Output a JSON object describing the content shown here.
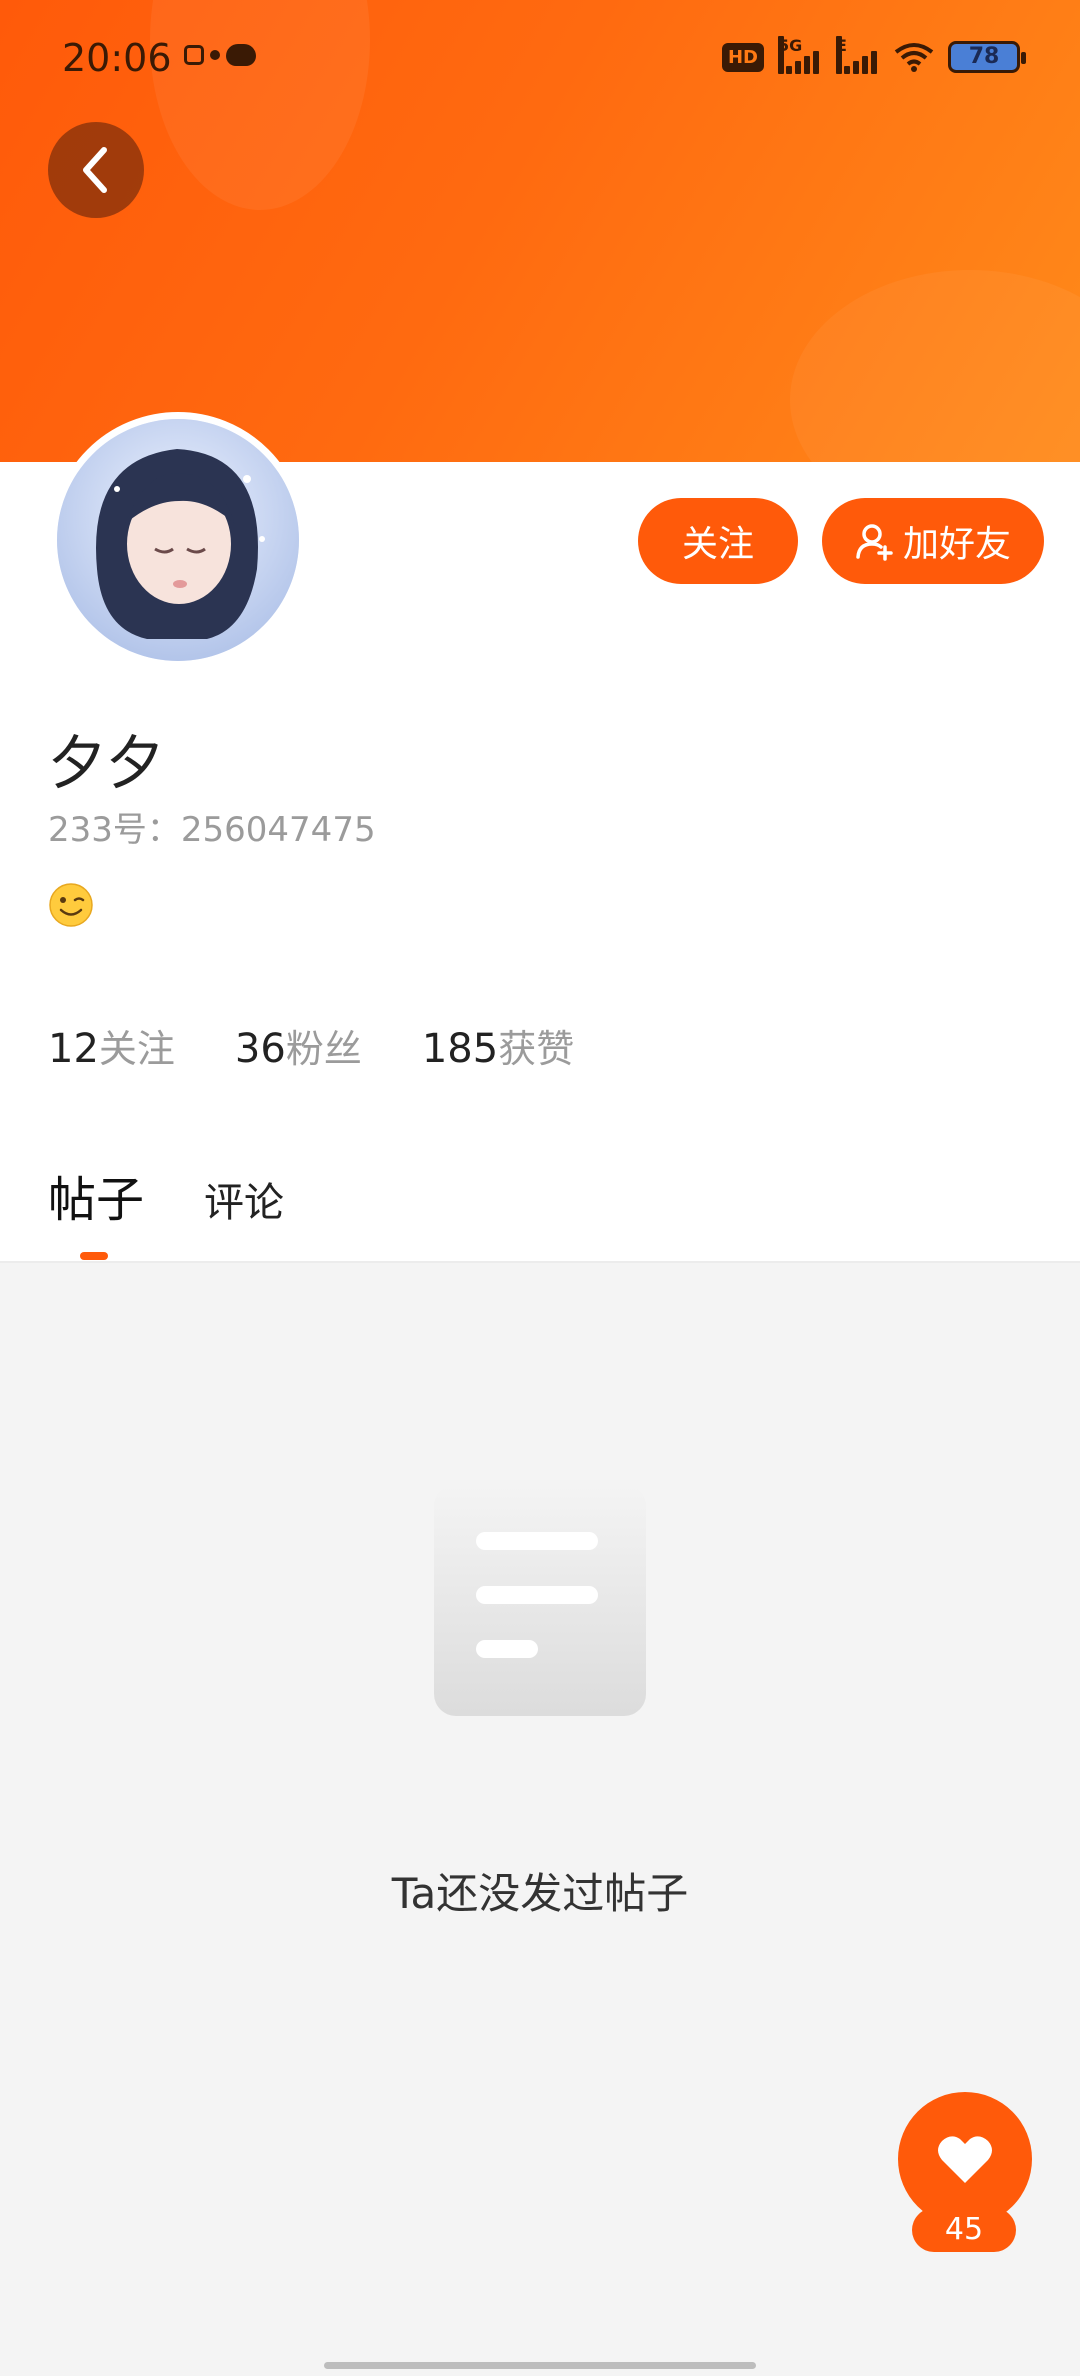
{
  "status_bar": {
    "time": "20:06",
    "hd_label": "HD",
    "signal1_label": "5G",
    "signal2_label": "E",
    "battery": "78"
  },
  "profile": {
    "name": "夕夕",
    "uid": "233号：256047475",
    "bio_emoji": "winking-face",
    "follow_label": "关注",
    "add_friend_label": "加好友"
  },
  "stats": [
    {
      "num": "12",
      "label": "关注"
    },
    {
      "num": "36",
      "label": "粉丝"
    },
    {
      "num": "185",
      "label": "获赞"
    }
  ],
  "tabs": {
    "posts": "帖子",
    "comments": "评论"
  },
  "empty": {
    "message": "Ta还没发过帖子"
  },
  "like_fab": {
    "count": "45"
  },
  "colors": {
    "accent": "#ff5a0a",
    "banner_end": "#ff8a1a"
  }
}
